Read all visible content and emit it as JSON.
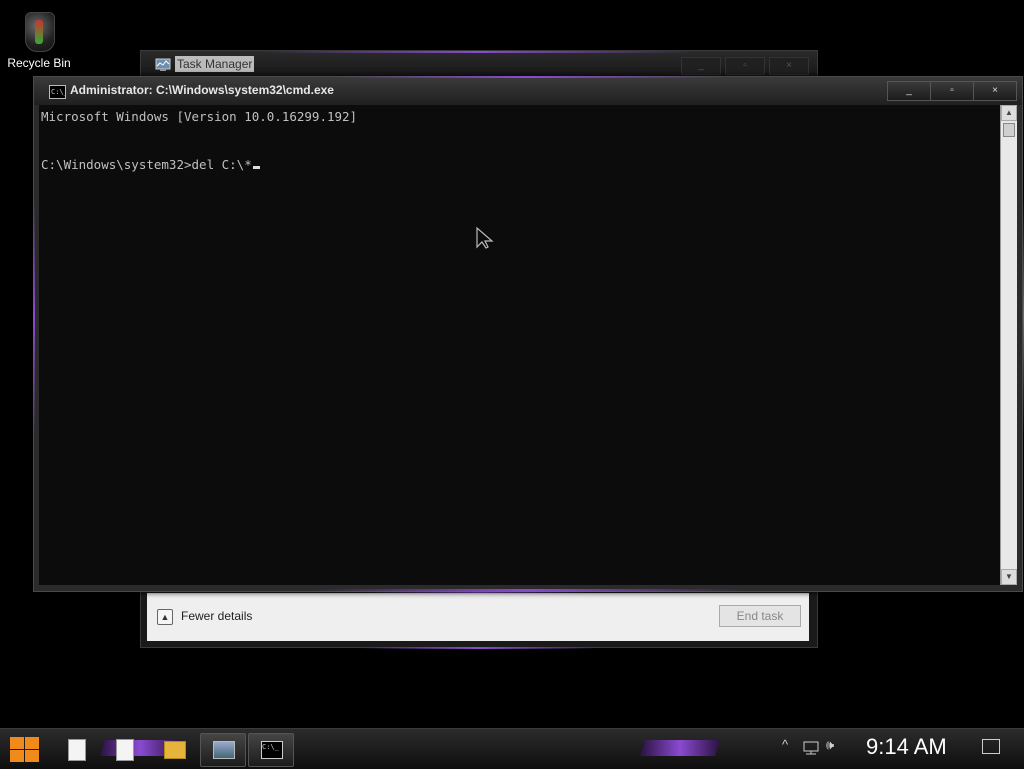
{
  "desktop": {
    "recycle_bin_label": "Recycle Bin"
  },
  "task_manager": {
    "title": "Task Manager",
    "minimize": "_",
    "maximize": "▫",
    "close": "×",
    "fewer_details_label": "Fewer details",
    "end_task_label": "End task"
  },
  "cmd": {
    "title": "Administrator: C:\\Windows\\system32\\cmd.exe",
    "minimize": "_",
    "maximize": "▫",
    "close": "×",
    "lines": {
      "version": "Microsoft Windows [Version 10.0.16299.192]",
      "blank": "",
      "prompt": "C:\\Windows\\system32>del C:\\*"
    }
  },
  "taskbar": {
    "clock": "9:14 AM",
    "tray_chevron": "^",
    "volume": "🕪"
  },
  "colors": {
    "accent": "#8a4bd0",
    "console_bg": "#0c0c0c",
    "console_text": "#c0c0c0"
  }
}
